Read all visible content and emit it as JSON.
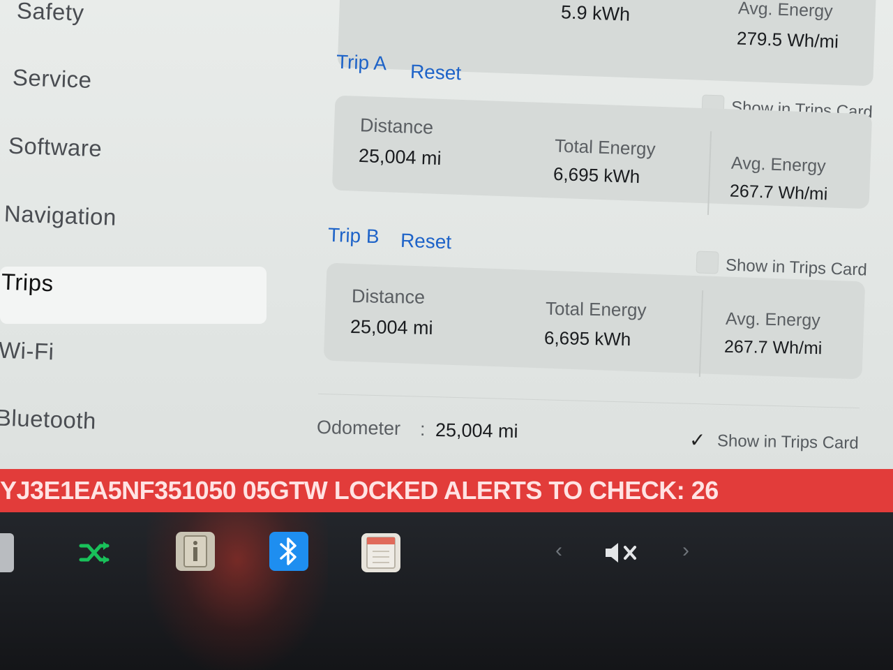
{
  "sidebar": {
    "items": [
      {
        "label": "Safety"
      },
      {
        "label": "Service"
      },
      {
        "label": "Software"
      },
      {
        "label": "Navigation"
      },
      {
        "label": "Trips"
      },
      {
        "label": "Wi-Fi"
      },
      {
        "label": "Bluetooth"
      }
    ],
    "active": "Trips"
  },
  "top_partial": {
    "energy": "5.9 kWh",
    "avg_label": "Avg. Energy",
    "avg_value": "279.5 Wh/mi"
  },
  "trip_a": {
    "title": "Trip A",
    "reset": "Reset",
    "show_label": "Show in Trips Card",
    "show_checked": false,
    "distance_label": "Distance",
    "distance_value": "25,004 mi",
    "energy_label": "Total Energy",
    "energy_value": "6,695 kWh",
    "avg_label": "Avg. Energy",
    "avg_value": "267.7 Wh/mi"
  },
  "trip_b": {
    "title": "Trip B",
    "reset": "Reset",
    "show_label": "Show in Trips Card",
    "show_checked": false,
    "distance_label": "Distance",
    "distance_value": "25,004 mi",
    "energy_label": "Total Energy",
    "energy_value": "6,695 kWh",
    "avg_label": "Avg. Energy",
    "avg_value": "267.7 Wh/mi"
  },
  "odometer": {
    "label": "Odometer",
    "separator": ":",
    "value": "25,004 mi",
    "show_label": "Show in Trips Card",
    "show_checked": true
  },
  "alert": {
    "text": "YJ3E1EA5NF351050 05GTW LOCKED  ALERTS TO CHECK: 26"
  },
  "dock": {
    "icons": [
      "app-edge-icon",
      "shuffle-icon",
      "info-card-icon",
      "bluetooth-icon",
      "calendar-icon"
    ],
    "volume_icon": "volume-mute-icon",
    "colors": {
      "bluetooth": "#1e8ef0",
      "shuffle": "#19c15a",
      "alert": "#e23c3a",
      "link": "#1e63c8"
    }
  }
}
